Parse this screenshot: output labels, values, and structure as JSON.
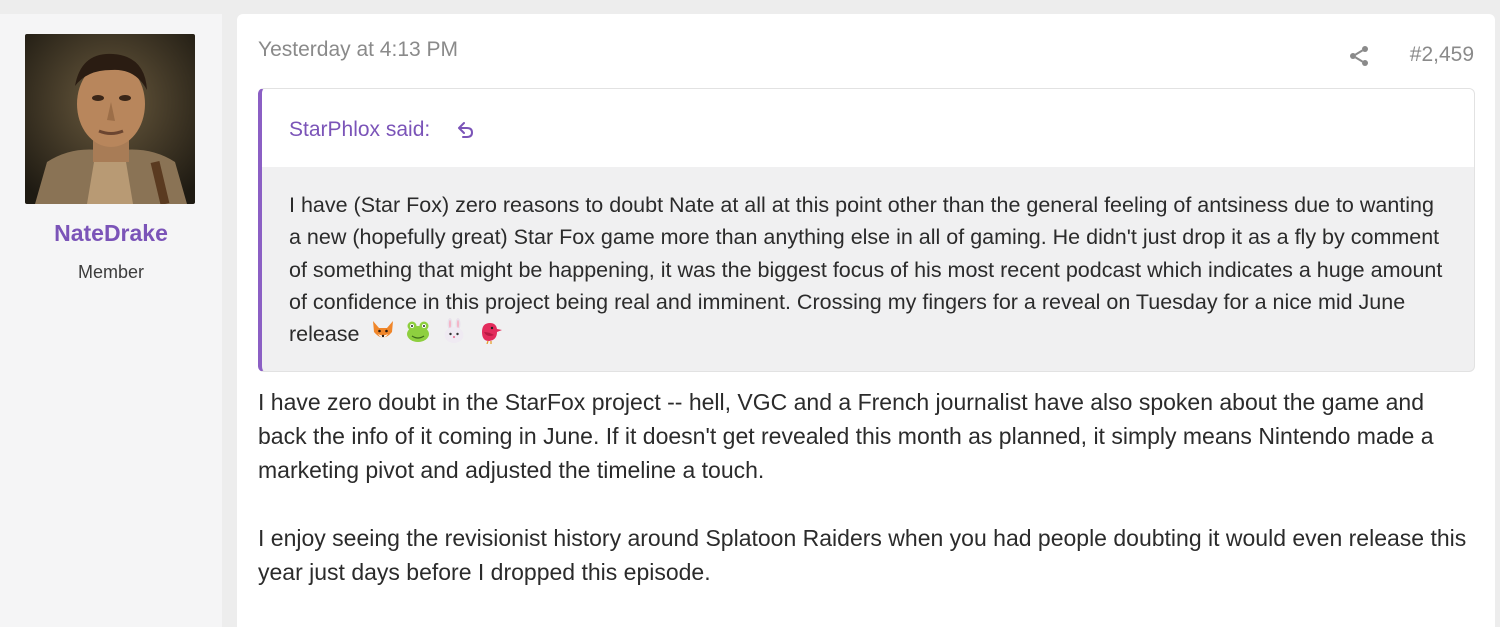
{
  "user": {
    "name": "NateDrake",
    "role": "Member"
  },
  "post": {
    "date": "Yesterday at 4:13 PM",
    "number": "#2,459",
    "quote": {
      "author": "StarPhlox said:",
      "text": "I have (Star Fox) zero reasons to doubt Nate at all at this point other than the general feeling of antsiness due to wanting a new (hopefully great) Star Fox game more than anything else in all of gaming. He didn't just drop it as a fly by comment of something that might be happening, it was the biggest focus of his most recent podcast which indicates a huge amount of confidence in this project being real and imminent. Crossing my fingers for a reveal on Tuesday for a nice mid June release",
      "emojis": [
        "fox-emoji",
        "frog-emoji",
        "rabbit-emoji",
        "bird-emoji"
      ]
    },
    "paragraphs": [
      "I have zero doubt in the StarFox project -- hell, VGC and a French journalist have also spoken about the game and back the info of it coming in June. If it doesn't get revealed this month as planned, it simply means Nintendo made a marketing pivot and adjusted the timeline a touch.",
      "I enjoy seeing the revisionist history around Splatoon Raiders when you had people doubting it would even release this year just days before I dropped this episode."
    ]
  },
  "colors": {
    "accent": "#7b54b8",
    "quote_border": "#8b5fc4",
    "muted_text": "#8a8a8a",
    "body_text": "#2b2b2b"
  }
}
